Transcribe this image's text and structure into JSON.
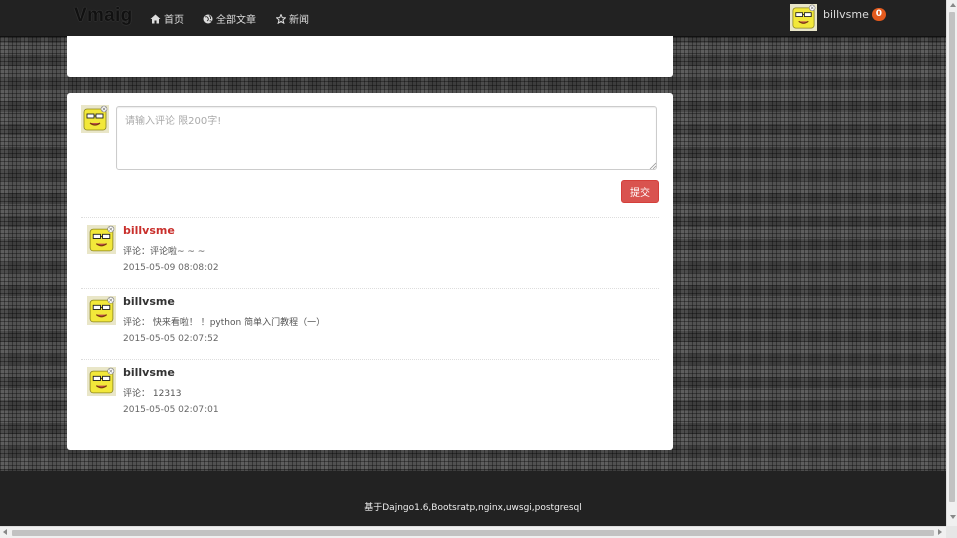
{
  "brand": "Vmaig",
  "nav": [
    {
      "label": "首页",
      "icon": "home-icon"
    },
    {
      "label": "全部文章",
      "icon": "globe-icon"
    },
    {
      "label": "新闻",
      "icon": "star-icon"
    }
  ],
  "user": {
    "name": "billvsme",
    "notifications": "0",
    "avatar_icon": "yellow-cartoon-avatar"
  },
  "comment_form": {
    "placeholder": "请输入评论 限200字!",
    "value": "",
    "submit_label": "提交"
  },
  "comments": [
    {
      "user": "billvsme",
      "text": "评论：评论啦~ ~ ~",
      "time": "2015-05-09 08:08:02"
    },
    {
      "user": "billvsme",
      "text": "评论： 快来看啦！ ！python 简单入门教程（一）",
      "time": "2015-05-05 02:07:52"
    },
    {
      "user": "billvsme",
      "text": "评论： 12313",
      "time": "2015-05-05 02:07:01"
    }
  ],
  "footer": {
    "text": "基于Dajngo1.6,Bootsratp,nginx,uwsgi,postgresql"
  },
  "colors": {
    "navbar": "#222222",
    "accent": "#d9534f",
    "badge": "#e35a1d",
    "avatar_yellow": "#f2e83a"
  }
}
